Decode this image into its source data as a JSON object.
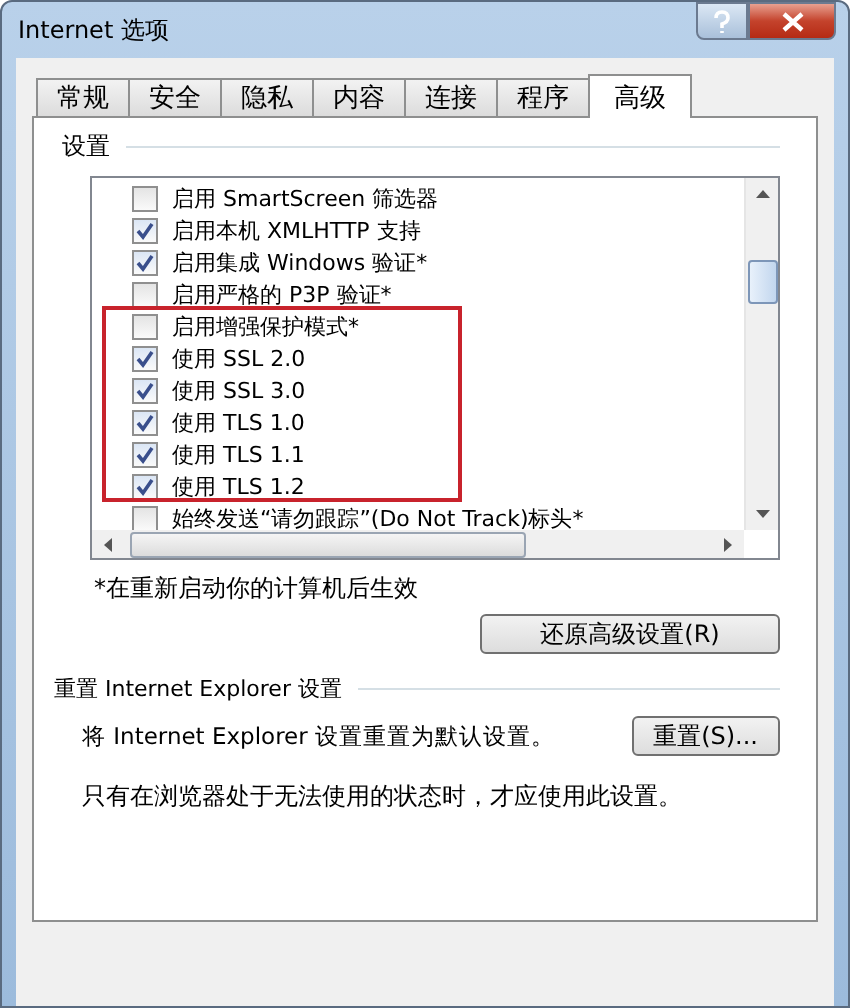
{
  "window": {
    "title": "Internet 选项"
  },
  "tabs": [
    {
      "label": "常规",
      "selected": false
    },
    {
      "label": "安全",
      "selected": false
    },
    {
      "label": "隐私",
      "selected": false
    },
    {
      "label": "内容",
      "selected": false
    },
    {
      "label": "连接",
      "selected": false
    },
    {
      "label": "程序",
      "selected": false
    },
    {
      "label": "高级",
      "selected": true
    }
  ],
  "settings": {
    "label": "设置",
    "items": [
      {
        "label": "启用 SmartScreen 筛选器",
        "checked": false
      },
      {
        "label": "启用本机 XMLHTTP 支持",
        "checked": true
      },
      {
        "label": "启用集成 Windows 验证*",
        "checked": true
      },
      {
        "label": "启用严格的 P3P 验证*",
        "checked": false
      },
      {
        "label": "启用增强保护模式*",
        "checked": false
      },
      {
        "label": "使用 SSL 2.0",
        "checked": true
      },
      {
        "label": "使用 SSL 3.0",
        "checked": true
      },
      {
        "label": "使用 TLS 1.0",
        "checked": true
      },
      {
        "label": "使用 TLS 1.1",
        "checked": true
      },
      {
        "label": "使用 TLS 1.2",
        "checked": true
      },
      {
        "label": "始终发送“请勿跟踪”(Do Not Track)标头*",
        "checked": false
      }
    ]
  },
  "restart_note": "*在重新启动你的计算机后生效",
  "restore_button": "还原高级设置(R)",
  "reset_group": {
    "label": "重置 Internet Explorer 设置",
    "description": "将 Internet Explorer 设置重置为默认设置。",
    "button": "重置(S)...",
    "note": "只有在浏览器处于无法使用的状态时，才应使用此设置。"
  }
}
